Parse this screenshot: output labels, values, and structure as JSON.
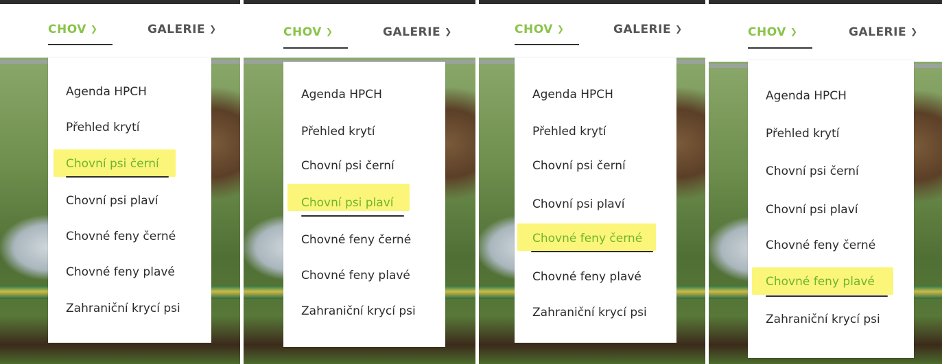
{
  "nav": {
    "chov_label": "CHOV",
    "chov_chevron": "chevron-down-icon",
    "galerie_label": "GALERIE",
    "galerie_chevron": "chevron-down-icon"
  },
  "menu": {
    "items": [
      "Agenda HPCH",
      "Přehled krytí",
      "Chovní psi černí",
      "Chovní psi plaví",
      "Chovné feny černé",
      "Chovné feny plavé",
      "Zahraniční krycí psi"
    ]
  },
  "panels": [
    {
      "highlighted_index": 2
    },
    {
      "highlighted_index": 3
    },
    {
      "highlighted_index": 4
    },
    {
      "highlighted_index": 5
    }
  ],
  "colors": {
    "accent_green": "#8bc34a",
    "highlighter_yellow": "#fbf57a",
    "text": "#2b2b2b",
    "nav_gray": "#555555"
  }
}
